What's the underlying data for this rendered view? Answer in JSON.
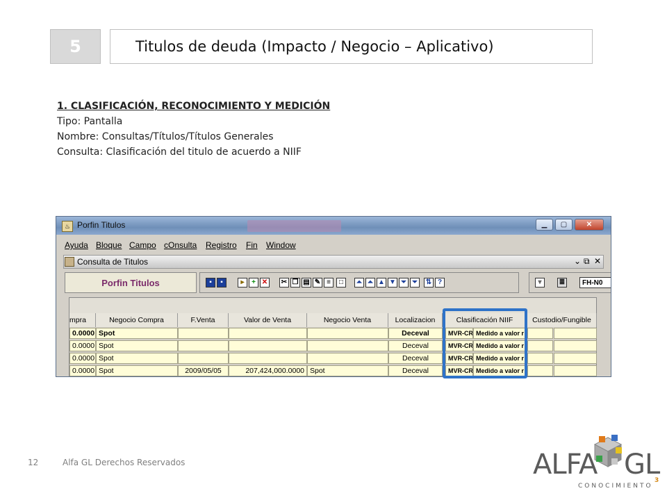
{
  "header": {
    "section_number": "5",
    "title": "Titulos de deuda (Impacto / Negocio – Aplicativo)"
  },
  "info": {
    "heading": "1. CLASIFICACIÓN, RECONOCIMIENTO Y MEDICIÓN",
    "line1": "Tipo: Pantalla",
    "line2": "Nombre: Consultas/Títulos/Títulos Generales",
    "line3": "Consulta: Clasificación del titulo de acuerdo a NIIF"
  },
  "app": {
    "window_title": "Porfin Titulos",
    "menu": [
      "Ayuda",
      "Bloque",
      "Campo",
      "cOnsulta",
      "Registro",
      "Fin",
      "Window"
    ],
    "subwindow_title": "Consulta de Titulos",
    "panel_label": "Porfin Titulos",
    "field_code": "FH-N0",
    "columns": [
      "mpra",
      "Negocio Compra",
      "F.Venta",
      "Valor de Venta",
      "Negocio Venta",
      "Localizacion",
      "Clasificación NIIF",
      "Custodio/Fungible"
    ],
    "rows": [
      {
        "compra": "0.0000",
        "negocio_compra": "Spot",
        "fventa": "",
        "valor_venta": "",
        "negocio_venta": "",
        "localizacion": "Deceval",
        "niif_code": "MVR-CR",
        "niif_desc": "Medido a valor r"
      },
      {
        "compra": "0.0000",
        "negocio_compra": "Spot",
        "fventa": "",
        "valor_venta": "",
        "negocio_venta": "",
        "localizacion": "Deceval",
        "niif_code": "MVR-CR",
        "niif_desc": "Medido a valor r"
      },
      {
        "compra": "0.0000",
        "negocio_compra": "Spot",
        "fventa": "",
        "valor_venta": "",
        "negocio_venta": "",
        "localizacion": "Deceval",
        "niif_code": "MVR-CR",
        "niif_desc": "Medido a valor r"
      },
      {
        "compra": "0.0000",
        "negocio_compra": "Spot",
        "fventa": "2009/05/05",
        "valor_venta": "207,424,000.0000",
        "negocio_venta": "Spot",
        "localizacion": "Deceval",
        "niif_code": "MVR-CR",
        "niif_desc": "Medido a valor r"
      }
    ]
  },
  "footer": {
    "page_number": "12",
    "copyright": "Alfa GL Derechos Reservados"
  },
  "logo": {
    "word1": "ALFA",
    "word2": "GL",
    "tagline": "CONOCIMIENTO",
    "superscript": "3"
  },
  "colors": {
    "highlight": "#2f73c8",
    "cell_bg": "#fffdd8",
    "number_box": "#d9d9d9"
  }
}
